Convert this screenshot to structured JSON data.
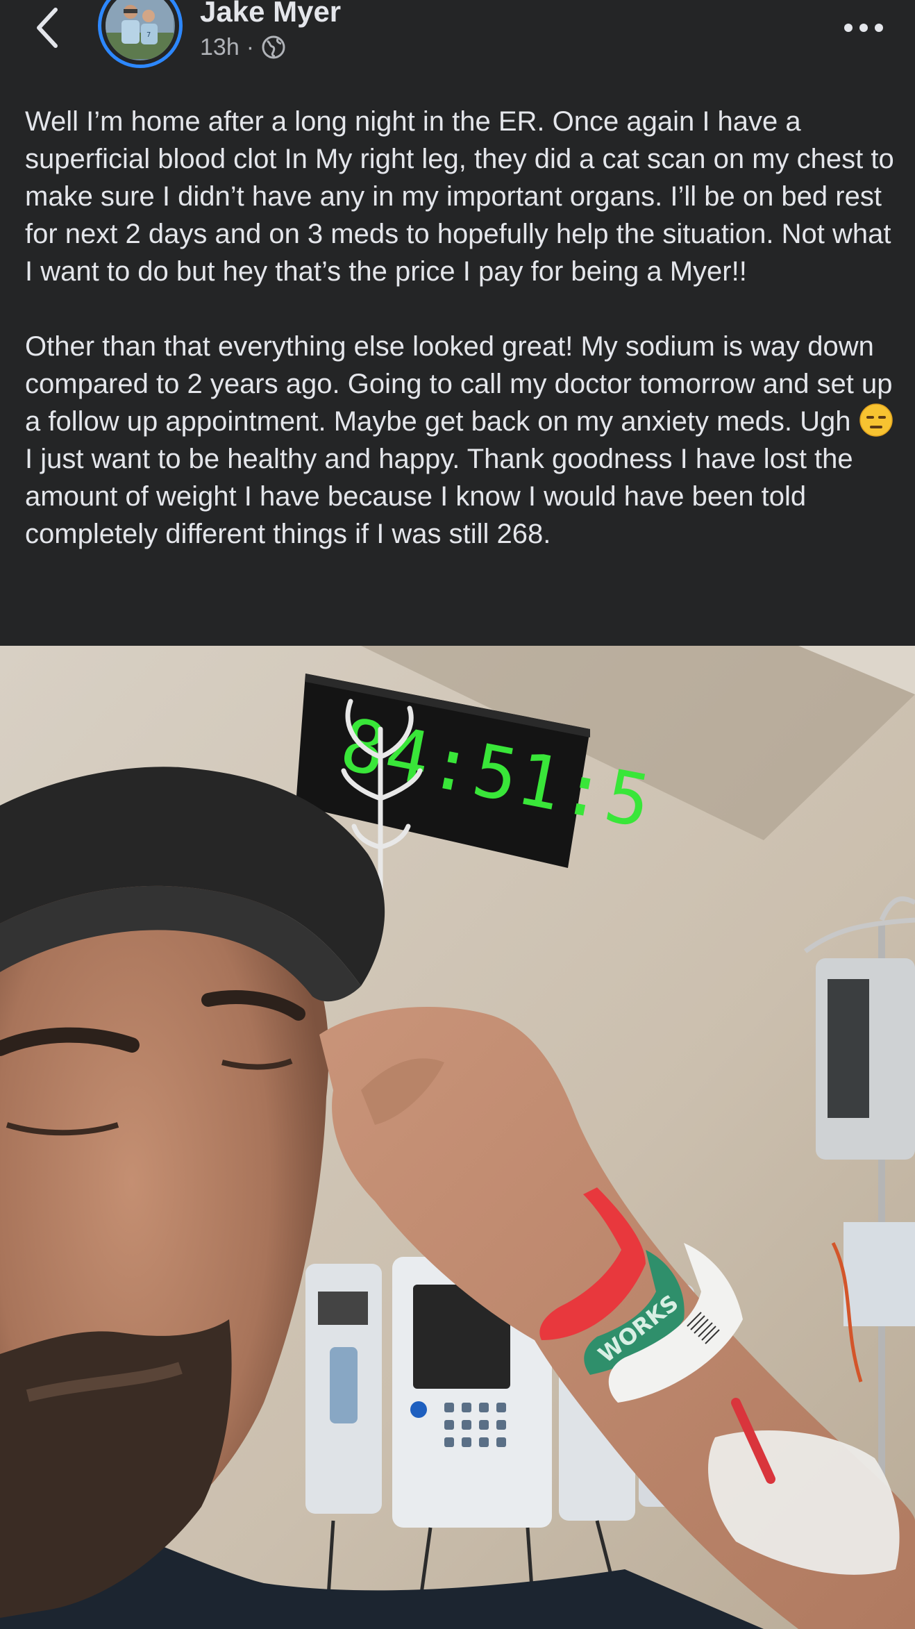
{
  "post": {
    "author_name": "Jake Myer",
    "time": "13h",
    "separator": "·",
    "privacy_icon": "globe-icon",
    "paragraph_1": "Well I’m home after a long night in the ER. Once again I have a superficial blood clot In My right leg, they did a cat scan on my chest to make sure I didn’t have any in my important organs. I’ll be on bed rest for next 2 days and on 3 meds to hopefully help the situation. Not what I want to do but hey that’s the price I pay for being a Myer!!",
    "paragraph_2_before_emoji": "Other than that everything else looked great! My sodium is way down compared to 2 years ago. Going to call my doctor tomorrow and set up a follow up appointment. Maybe get back on my anxiety meds. Ugh ",
    "paragraph_2_after_emoji": " I just want to be healthy and happy. Thank goodness I have lost the amount of weight I have because I know I would have been told completely different things if I was still 268.",
    "emoji_icon": "expressionless-face-icon"
  },
  "photo": {
    "clock_text": "84:51:5",
    "wristband_text": "WORKS"
  },
  "colors": {
    "background": "#242526",
    "text_primary": "#e4e6eb",
    "text_secondary": "#b0b3b8",
    "avatar_ring": "#2d88ff",
    "clock_digits": "#39e639"
  }
}
